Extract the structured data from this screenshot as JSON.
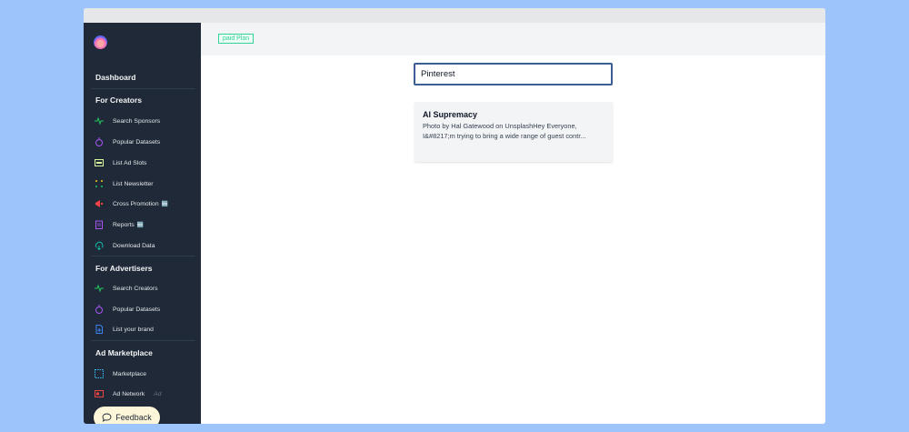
{
  "topbar": {
    "plan_badge": "paid Plan"
  },
  "search": {
    "value": "Pinterest"
  },
  "sidebar": {
    "dashboard": "Dashboard",
    "creators": {
      "title": "For Creators",
      "items": [
        {
          "label": "Search Sponsors",
          "icon": "activity-icon",
          "badge": ""
        },
        {
          "label": "Popular Datasets",
          "icon": "timer-icon",
          "badge": ""
        },
        {
          "label": "List Ad Slots",
          "icon": "ad-icon",
          "badge": ""
        },
        {
          "label": "List Newsletter",
          "icon": "dots-icon",
          "badge": ""
        },
        {
          "label": "Cross Promotion",
          "icon": "megaphone-icon",
          "badge": "🆕"
        },
        {
          "label": "Reports",
          "icon": "report-icon",
          "badge": "🆕"
        },
        {
          "label": "Download Data",
          "icon": "cloud-download-icon",
          "badge": ""
        }
      ]
    },
    "advertisers": {
      "title": "For Advertisers",
      "items": [
        {
          "label": "Search Creators",
          "icon": "activity-icon"
        },
        {
          "label": "Popular Datasets",
          "icon": "timer-icon"
        },
        {
          "label": "List your brand",
          "icon": "file-plus-icon"
        }
      ]
    },
    "marketplace": {
      "title": "Ad Marketplace",
      "items": [
        {
          "label": "Marketplace",
          "icon": "grid-icon",
          "suffix": ""
        },
        {
          "label": "Ad Network",
          "icon": "ad-network-icon",
          "suffix": "Ad"
        }
      ]
    }
  },
  "results": [
    {
      "title": "AI Supremacy",
      "snippet": "Photo by Hal Gatewood on UnsplashHey Everyone, I&#8217;m trying to bring a wide range of guest contr..."
    }
  ],
  "feedback": {
    "label": "Feedback"
  },
  "colors": {
    "sidebar_bg": "#1f2937",
    "page_bg": "#9dc4fb",
    "plan_green": "#34d399",
    "search_border": "#3b5f94"
  }
}
